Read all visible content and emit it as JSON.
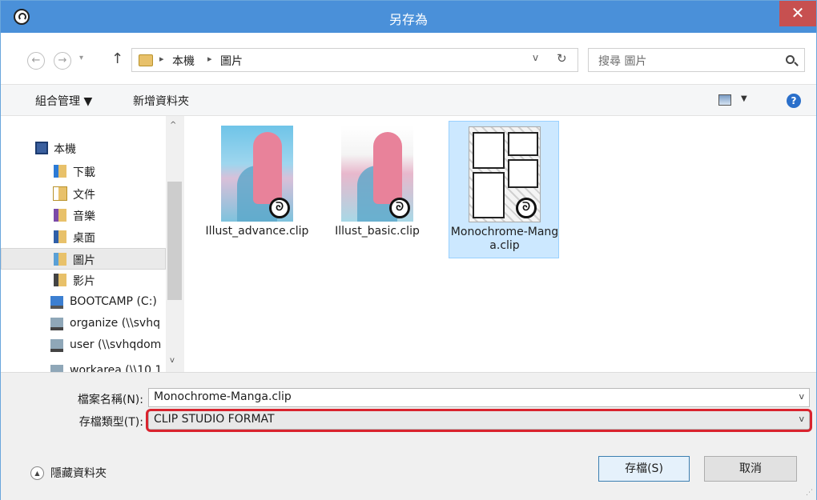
{
  "window": {
    "title": "另存為",
    "close_glyph": "✕"
  },
  "address": {
    "back_glyph": "←",
    "forward_glyph": "→",
    "recent_glyph": "▾",
    "up_glyph": "↑",
    "crumb_sep": "▸",
    "crumbs": [
      "本機",
      "圖片"
    ],
    "dropdown_glyph": "v",
    "refresh_glyph": "↻",
    "search_placeholder": "搜尋 圖片"
  },
  "toolbar": {
    "organize_label": "組合管理 ▼",
    "new_folder_label": "新增資料夾",
    "view_dropdown_glyph": "▼",
    "help_glyph": "?"
  },
  "nav_pane": {
    "items": [
      {
        "label": "本機",
        "icon": "computer-icon"
      },
      {
        "label": "下載",
        "icon": "downloads-folder-icon"
      },
      {
        "label": "文件",
        "icon": "documents-folder-icon"
      },
      {
        "label": "音樂",
        "icon": "music-folder-icon"
      },
      {
        "label": "桌面",
        "icon": "desktop-folder-icon"
      },
      {
        "label": "圖片",
        "icon": "pictures-folder-icon",
        "selected": true
      },
      {
        "label": "影片",
        "icon": "videos-folder-icon"
      },
      {
        "label": "BOOTCAMP (C:)",
        "icon": "drive-icon"
      },
      {
        "label": "organize (\\\\svhq",
        "icon": "network-drive-icon"
      },
      {
        "label": "user (\\\\svhqdom",
        "icon": "network-drive-icon"
      },
      {
        "label": "workarea (\\\\10.1",
        "icon": "network-drive-icon"
      }
    ],
    "scroll_up_glyph": "^",
    "scroll_down_glyph": "v"
  },
  "files": [
    {
      "name": "Illust_advance.clip",
      "selected": false
    },
    {
      "name": "Illust_basic.clip",
      "selected": false
    },
    {
      "name": "Monochrome-Manga.clip",
      "selected": true
    }
  ],
  "clip_badge": "ᘐ",
  "fields": {
    "filename_label": "檔案名稱(N):",
    "filename_value": "Monochrome-Manga.clip",
    "filetype_label": "存檔類型(T):",
    "filetype_value": "CLIP STUDIO FORMAT",
    "dropdown_glyph": "v"
  },
  "footer": {
    "hide_folders_glyph": "▲",
    "hide_folders_label": "隱藏資料夾",
    "save_label": "存檔(S)",
    "cancel_label": "取消",
    "grip_glyph": "⋰"
  },
  "colors": {
    "titlebar": "#4a90d9",
    "close": "#c75050",
    "selection": "#cce8ff",
    "highlight": "#d9232e"
  }
}
